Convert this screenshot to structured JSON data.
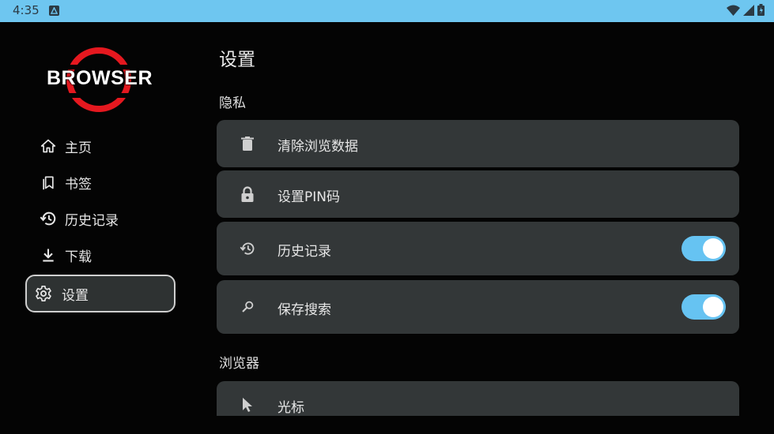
{
  "status_bar": {
    "time": "4:35",
    "colors": {
      "background": "#6ec6f0"
    }
  },
  "logo": {
    "text": "BROWSER",
    "ring_color": "#e5181f"
  },
  "sidebar": {
    "items": [
      {
        "label": "主页",
        "icon": "home-icon"
      },
      {
        "label": "书签",
        "icon": "bookmarks-icon"
      },
      {
        "label": "历史记录",
        "icon": "history-icon"
      },
      {
        "label": "下载",
        "icon": "download-icon"
      },
      {
        "label": "设置",
        "icon": "gear-icon",
        "selected": true
      }
    ]
  },
  "main": {
    "title": "设置",
    "sections": [
      {
        "title": "隐私",
        "items": [
          {
            "label": "清除浏览数据",
            "icon": "trash-icon"
          },
          {
            "label": "设置PIN码",
            "icon": "lock-icon"
          },
          {
            "label": "历史记录",
            "icon": "history-icon",
            "toggle": true,
            "toggle_on": true
          },
          {
            "label": "保存搜索",
            "icon": "search-icon",
            "toggle": true,
            "toggle_on": true
          }
        ]
      },
      {
        "title": "浏览器",
        "items": [
          {
            "label": "光标",
            "icon": "cursor-icon"
          }
        ]
      }
    ]
  },
  "colors": {
    "background": "#040404",
    "card": "#333738",
    "toggle_on": "#66c3f2",
    "selected_nav": "#2e3232"
  }
}
